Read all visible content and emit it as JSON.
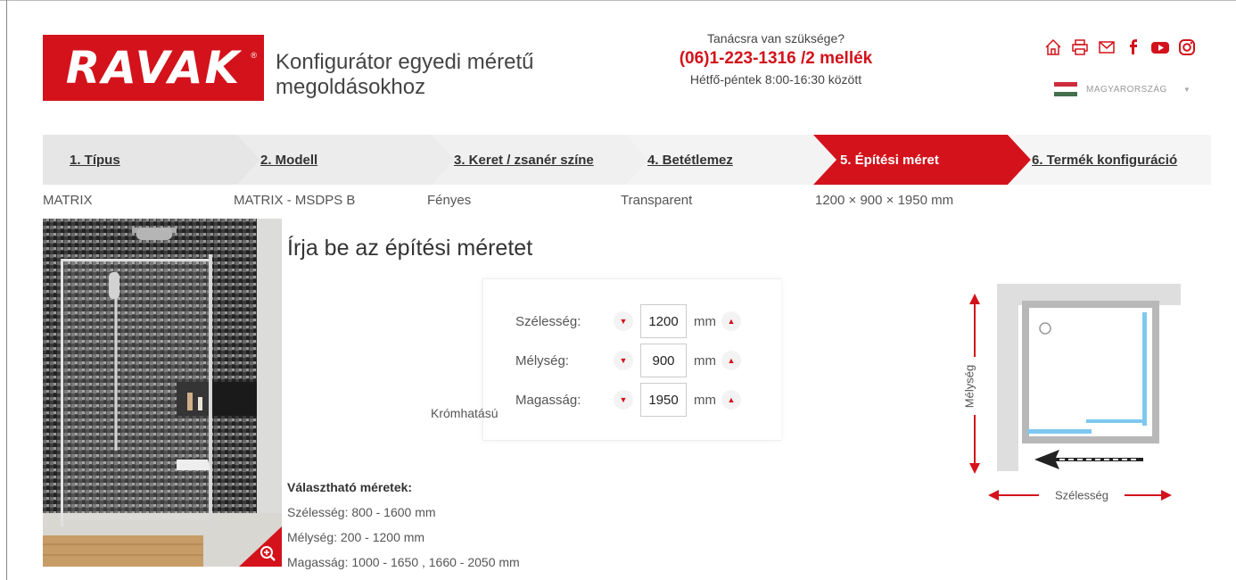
{
  "header": {
    "logo": "RAVAK",
    "tagline": "Konfigurátor egyedi méretű megoldásokhoz",
    "help_question": "Tanácsra van szüksége?",
    "help_phone": "(06)1-223-1316 /2 mellék",
    "help_hours": "Hétfő-péntek 8:00-16:30 között",
    "social_icons": [
      "home-icon",
      "print-icon",
      "mail-icon",
      "facebook-icon",
      "youtube-icon",
      "instagram-icon"
    ],
    "language": "MAGYARORSZÁG"
  },
  "steps": [
    {
      "label": "1. Típus",
      "value": "MATRIX"
    },
    {
      "label": "2. Modell",
      "value": "MATRIX - MSDPS B"
    },
    {
      "label": "3. Keret / zsanér színe",
      "value": "Fényes"
    },
    {
      "label": "4. Betétlemez",
      "value": "Transparent"
    },
    {
      "label": "5. Építési méret",
      "value": "1200 × 900 × 1950 mm",
      "active": true
    },
    {
      "label": "6. Termék konfiguráció",
      "value": ""
    }
  ],
  "main": {
    "title": "Írja be az építési méretet",
    "finish_label": "Krómhatású",
    "dimensions": [
      {
        "label": "Szélesség:",
        "value": "1200",
        "unit": "mm"
      },
      {
        "label": "Mélység:",
        "value": "900",
        "unit": "mm"
      },
      {
        "label": "Magasság:",
        "value": "1950",
        "unit": "mm"
      }
    ],
    "available_heading": "Választható méretek:",
    "available": [
      "Szélesség: 800 - 1600 mm",
      "Mélység: 200 - 1200 mm",
      "Magasság: 1000 - 1650 , 1660 - 2050 mm"
    ],
    "diagram": {
      "depth_label": "Mélység",
      "width_label": "Szélesség"
    }
  },
  "colors": {
    "brand_red": "#d3121b",
    "glass_blue": "#7ec8f0",
    "step_grey": "#ececec"
  }
}
